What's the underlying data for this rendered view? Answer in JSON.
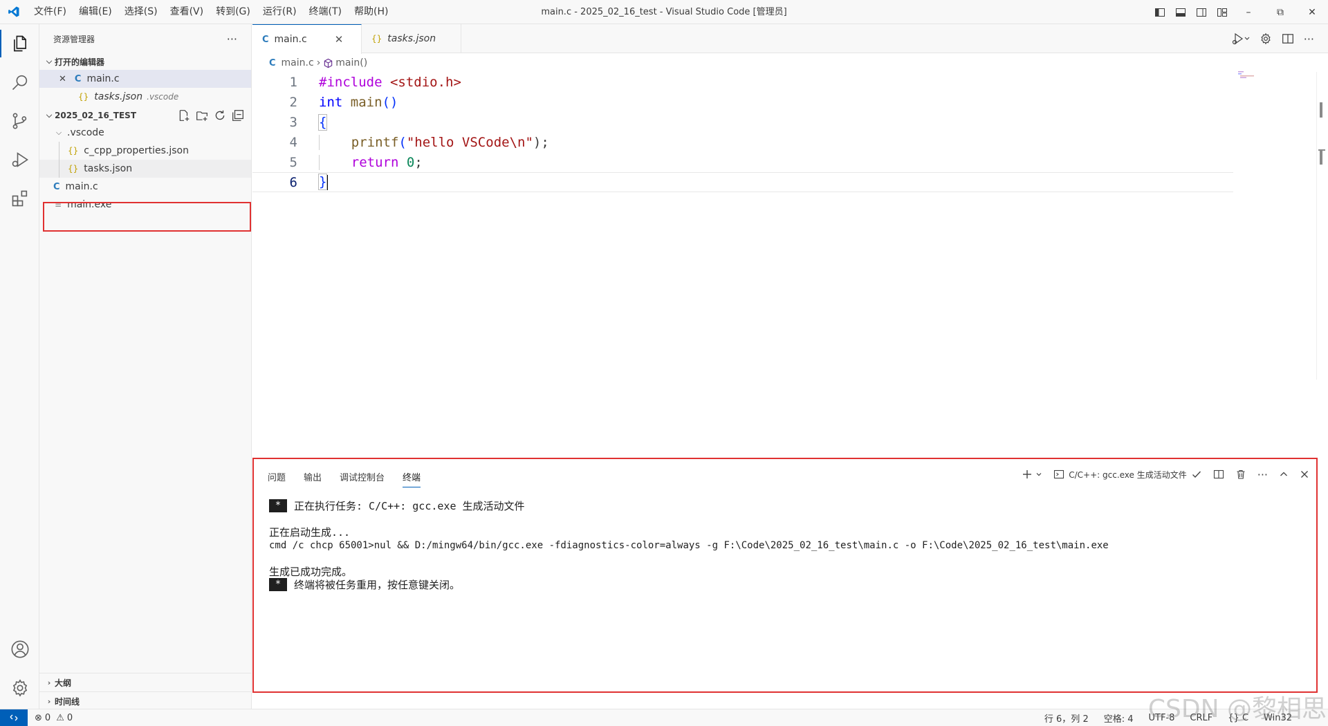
{
  "titlebar": {
    "menu": [
      "文件(F)",
      "编辑(E)",
      "选择(S)",
      "查看(V)",
      "转到(G)",
      "运行(R)",
      "终端(T)",
      "帮助(H)"
    ],
    "window_title": "main.c - 2025_02_16_test - Visual Studio Code [管理员]",
    "minimize": "–",
    "restore": "⧉",
    "close": "✕"
  },
  "sidebar": {
    "title": "资源管理器",
    "more": "···",
    "open_editors_label": "打开的编辑器",
    "open_editors": [
      {
        "icon": "C",
        "name": "main.c",
        "close": "✕"
      },
      {
        "icon": "{}",
        "name": "tasks.json",
        "hint": ".vscode"
      }
    ],
    "folder_label": "2025_02_16_TEST",
    "tree": {
      "vscode_folder": ".vscode",
      "c_cpp_properties": "c_cpp_properties.json",
      "tasks": "tasks.json",
      "main_c": "main.c",
      "main_exe": "main.exe"
    },
    "outline": "大纲",
    "timeline": "时间线"
  },
  "editor": {
    "tabs": [
      {
        "icon": "C",
        "label": "main.c",
        "close": "✕"
      },
      {
        "icon": "{}",
        "label": "tasks.json"
      }
    ],
    "breadcrumb": {
      "file": "main.c",
      "sep": "›",
      "symbol": "main()"
    },
    "line_numbers": [
      "1",
      "2",
      "3",
      "4",
      "5",
      "6"
    ],
    "code": {
      "l1_directive": "#include",
      "l1_header": " <stdio.h>",
      "l2_type": "int",
      "l2_fn": " main",
      "l2_parens": "()",
      "l3": "{",
      "l4_indent": "    ",
      "l4_fn": "printf",
      "l4_open": "(",
      "l4_str": "\"hello VSCode\\n\"",
      "l4_close": ");",
      "l5_indent": "    ",
      "l5_kw": "return",
      "l5_sp": " ",
      "l5_num": "0",
      "l5_end": ";",
      "l6": "}"
    }
  },
  "panel": {
    "tabs": [
      "问题",
      "输出",
      "调试控制台",
      "终端"
    ],
    "active_tab": "终端",
    "task_label": "C/C++: gcc.exe 生成活动文件",
    "terminal": {
      "star": "*",
      "line1": "正在执行任务: C/C++: gcc.exe 生成活动文件",
      "line2": "正在启动生成...",
      "line3": "cmd /c chcp 65001>nul && D:/mingw64/bin/gcc.exe -fdiagnostics-color=always -g F:\\Code\\2025_02_16_test\\main.c -o F:\\Code\\2025_02_16_test\\main.exe",
      "line4": "生成已成功完成。",
      "line5": "终端将被任务重用，按任意键关闭。"
    }
  },
  "statusbar": {
    "errors": "0",
    "warnings": "0",
    "position": "行 6，列 2",
    "spaces": "空格: 4",
    "encoding": "UTF-8",
    "eol": "CRLF",
    "language": "{} C",
    "platform": "Win32"
  },
  "watermark": "CSDN @黎相思",
  "colors": {
    "accent": "#005fb8",
    "highlight_box": "#e03131"
  }
}
